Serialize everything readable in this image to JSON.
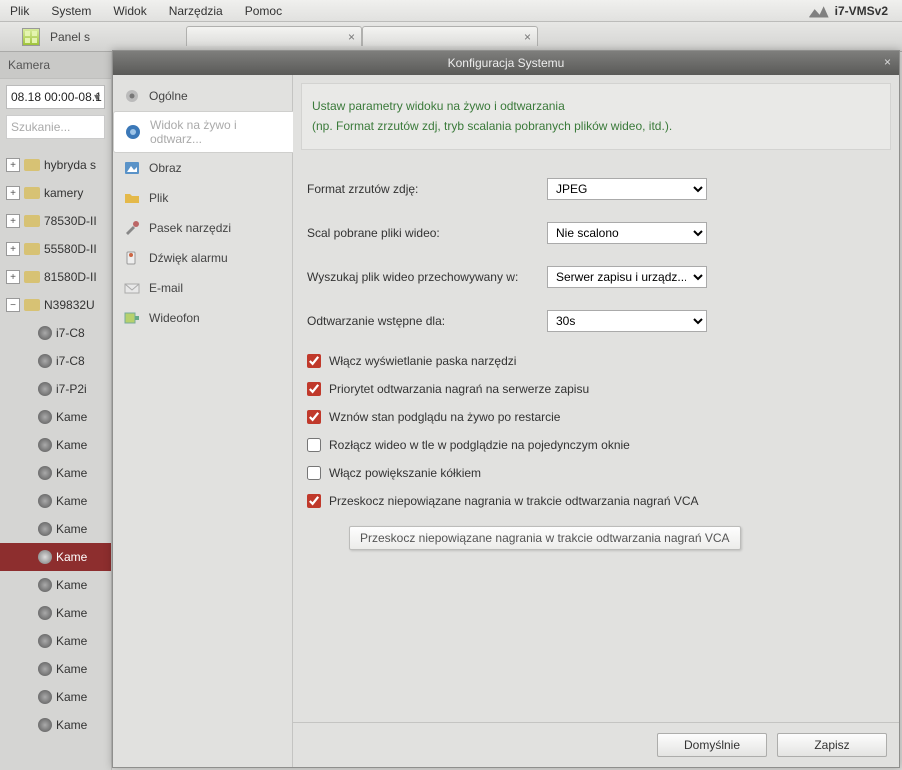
{
  "menu": {
    "file": "Plik",
    "system": "System",
    "view": "Widok",
    "tools": "Narzędzia",
    "help": "Pomoc"
  },
  "brand": "i7-VMSv2",
  "toolbar": {
    "panel": "Panel s"
  },
  "tab_close": "×",
  "side": {
    "head": "Kamera",
    "date": "08.18 00:00-08.1",
    "search": "Szukanie..."
  },
  "tree": {
    "plus": "+",
    "minus": "−",
    "items": [
      {
        "label": "hybryda s"
      },
      {
        "label": "kamery"
      },
      {
        "label": "78530D-II"
      },
      {
        "label": "55580D-II"
      },
      {
        "label": "81580D-II"
      }
    ],
    "open": {
      "label": "N39832U",
      "cams": [
        "i7-C8",
        "i7-C8",
        "i7-P2i",
        "Kame",
        "Kame",
        "Kame",
        "Kame",
        "Kame",
        "Kame",
        "Kame",
        "Kame",
        "Kame",
        "Kame",
        "Kame",
        "Kame"
      ]
    }
  },
  "dlg": {
    "title": "Konfiguracja Systemu",
    "close": "×",
    "nav": {
      "general": "Ogólne",
      "live": "Widok na żywo i odtwarz...",
      "image": "Obraz",
      "file": "Plik",
      "toolbar": "Pasek narzędzi",
      "alarm": "Dźwięk alarmu",
      "email": "E-mail",
      "videophone": "Wideofon"
    },
    "notice1": "Ustaw parametry widoku na żywo i odtwarzania",
    "notice2": "(np. Format zrzutów zdj, tryb scalania pobranych plików wideo, itd.).",
    "form": {
      "l_format": "Format zrzutów zdję:",
      "v_format": "JPEG",
      "l_merge": "Scal pobrane pliki wideo:",
      "v_merge": "Nie scalono",
      "l_search": "Wyszukaj plik wideo przechowywany w:",
      "v_search": "Serwer zapisu i urządz...",
      "l_pre": "Odtwarzanie wstępne dla:",
      "v_pre": "30s"
    },
    "chk": {
      "c1": "Włącz wyświetlanie paska narzędzi",
      "c2": "Priorytet odtwarzania nagrań na serwerze zapisu",
      "c3": "Wznów stan podglądu na żywo po restarcie",
      "c4": "Rozłącz wideo w tle w podglądzie na pojedynczym oknie",
      "c5": "Włącz powiększanie kółkiem",
      "c6": "Przeskocz niepowiązane nagrania w trakcie odtwarzania nagrań VCA"
    },
    "tooltip": "Przeskocz niepowiązane nagrania w trakcie odtwarzania nagrań VCA",
    "btn_default": "Domyślnie",
    "btn_save": "Zapisz"
  }
}
